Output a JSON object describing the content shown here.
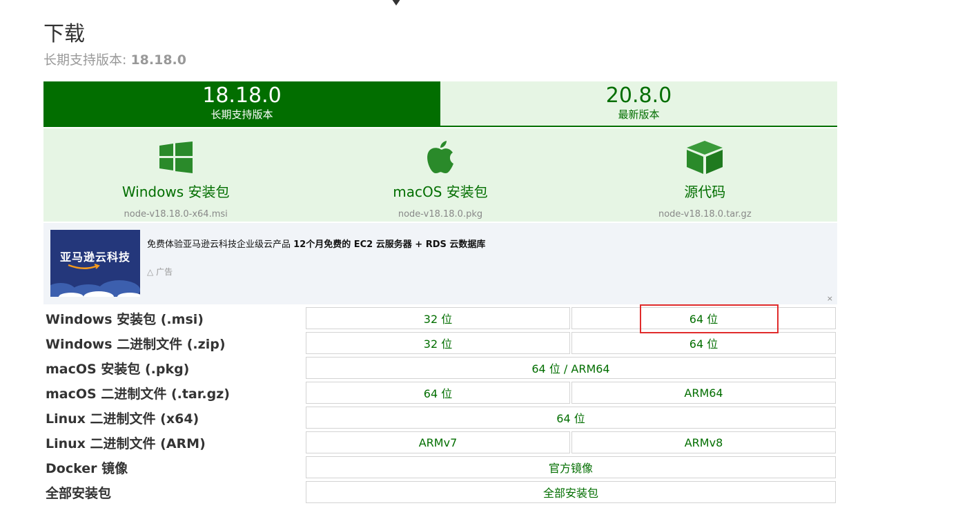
{
  "page": {
    "title": "下载",
    "subtitle_prefix": "长期支持版本: ",
    "subtitle_version": "18.18.0"
  },
  "tabs": [
    {
      "version": "18.18.0",
      "tag": "长期支持版本",
      "active": true
    },
    {
      "version": "20.8.0",
      "tag": "最新版本",
      "active": false
    }
  ],
  "installers": [
    {
      "icon": "windows-icon",
      "name": "Windows 安装包",
      "file": "node-v18.18.0-x64.msi"
    },
    {
      "icon": "apple-icon",
      "name": "macOS 安装包",
      "file": "node-v18.18.0.pkg"
    },
    {
      "icon": "cube-icon",
      "name": "源代码",
      "file": "node-v18.18.0.tar.gz"
    }
  ],
  "ad": {
    "logo_text": "亚马逊云科技",
    "text_normal": "免费体验亚马逊云科技企业级云产品 ",
    "text_bold": "12个月免费的 EC2 云服务器 + RDS 云数据库",
    "label": "广告",
    "close": "×"
  },
  "downloads": [
    {
      "label": "Windows 安装包 (.msi)",
      "cells": [
        "32 位",
        "64 位"
      ]
    },
    {
      "label": "Windows 二进制文件 (.zip)",
      "cells": [
        "32 位",
        "64 位"
      ]
    },
    {
      "label": "macOS 安装包 (.pkg)",
      "cells": [
        "64 位 / ARM64"
      ]
    },
    {
      "label": "macOS 二进制文件 (.tar.gz)",
      "cells": [
        "64 位",
        "ARM64"
      ]
    },
    {
      "label": "Linux 二进制文件 (x64)",
      "cells": [
        "64 位"
      ]
    },
    {
      "label": "Linux 二进制文件 (ARM)",
      "cells": [
        "ARMv7",
        "ARMv8"
      ]
    },
    {
      "label": "Docker 镜像",
      "cells": [
        "官方镜像"
      ]
    },
    {
      "label": "全部安装包",
      "cells": [
        "全部安装包"
      ]
    }
  ],
  "colors": {
    "brand_green": "#026e00",
    "light_green": "#e6f5e4",
    "highlight_red": "#e02b2b"
  }
}
